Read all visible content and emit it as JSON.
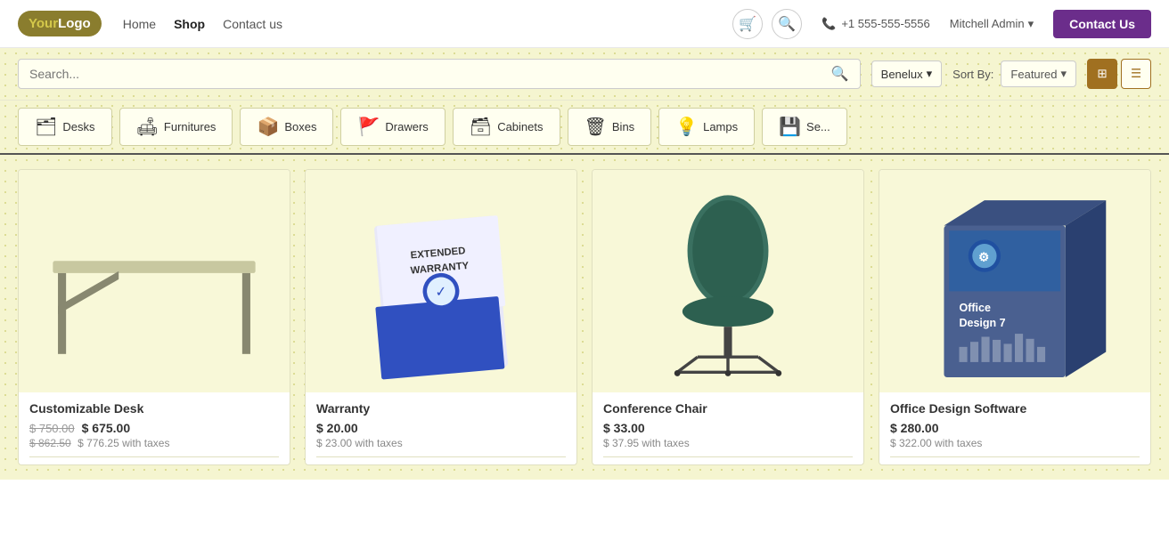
{
  "logo": {
    "text_your": "Your",
    "text_logo": "Logo"
  },
  "nav": {
    "links": [
      {
        "label": "Home",
        "active": false
      },
      {
        "label": "Shop",
        "active": true
      },
      {
        "label": "Contact us",
        "active": false
      }
    ],
    "phone": "+1 555-555-5556",
    "user": "Mitchell Admin",
    "contact_btn": "Contact Us"
  },
  "search": {
    "placeholder": "Search...",
    "region": "Benelux",
    "sort_label": "Sort By:",
    "sort_value": "Featured"
  },
  "categories": [
    {
      "label": "Desks",
      "icon": "🗂"
    },
    {
      "label": "Furnitures",
      "icon": "🛋"
    },
    {
      "label": "Boxes",
      "icon": "📦"
    },
    {
      "label": "Drawers",
      "icon": "🚩"
    },
    {
      "label": "Cabinets",
      "icon": "🗃"
    },
    {
      "label": "Bins",
      "icon": "🗑"
    },
    {
      "label": "Lamps",
      "icon": "💡"
    },
    {
      "label": "Se...",
      "icon": "💾"
    }
  ],
  "products": [
    {
      "name": "Customizable Desk",
      "price_original": "$ 750.00",
      "price_current": "$ 675.00",
      "price_original2": "$ 862.50",
      "price_tax": "$ 776.25 with taxes",
      "type": "desk"
    },
    {
      "name": "Warranty",
      "price_current": "$ 20.00",
      "price_tax": "$ 23.00 with taxes",
      "type": "warranty"
    },
    {
      "name": "Conference Chair",
      "price_current": "$ 33.00",
      "price_tax": "$ 37.95 with taxes",
      "type": "chair"
    },
    {
      "name": "Office Design Software",
      "price_current": "$ 280.00",
      "price_tax": "$ 322.00 with taxes",
      "type": "software"
    }
  ]
}
